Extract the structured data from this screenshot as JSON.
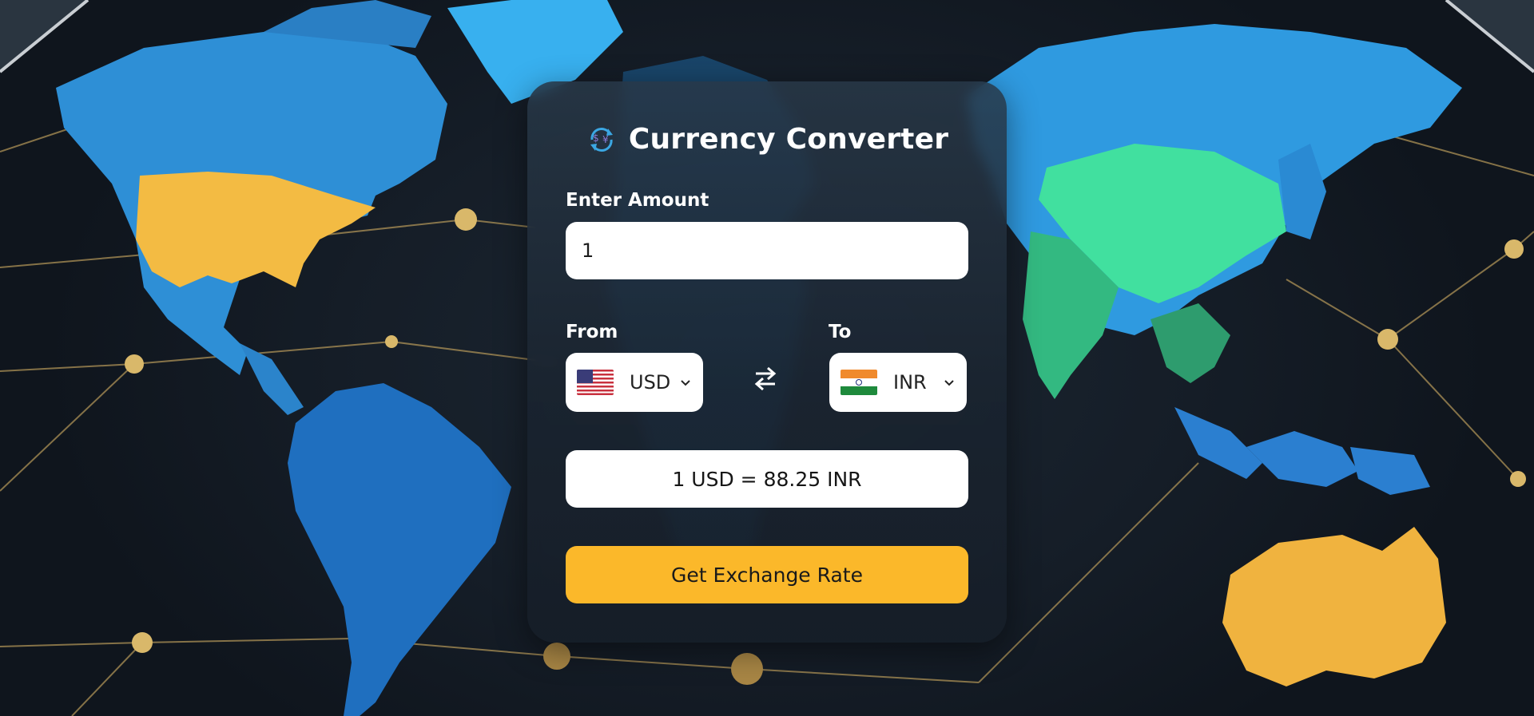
{
  "app": {
    "title": "Currency Converter",
    "title_icon": "currency-exchange-icon"
  },
  "amount": {
    "label": "Enter Amount",
    "value": "1"
  },
  "from": {
    "label": "From",
    "currency": "USD",
    "flag": "us-flag-icon"
  },
  "to": {
    "label": "To",
    "currency": "INR",
    "flag": "india-flag-icon"
  },
  "swap_icon": "swap-arrows-icon",
  "result": {
    "text": "1 USD = 88.25 INR"
  },
  "button": {
    "label": "Get Exchange Rate"
  },
  "colors": {
    "accent": "#fbb82a",
    "card": "#1e2a36",
    "text_light": "#ffffff"
  }
}
